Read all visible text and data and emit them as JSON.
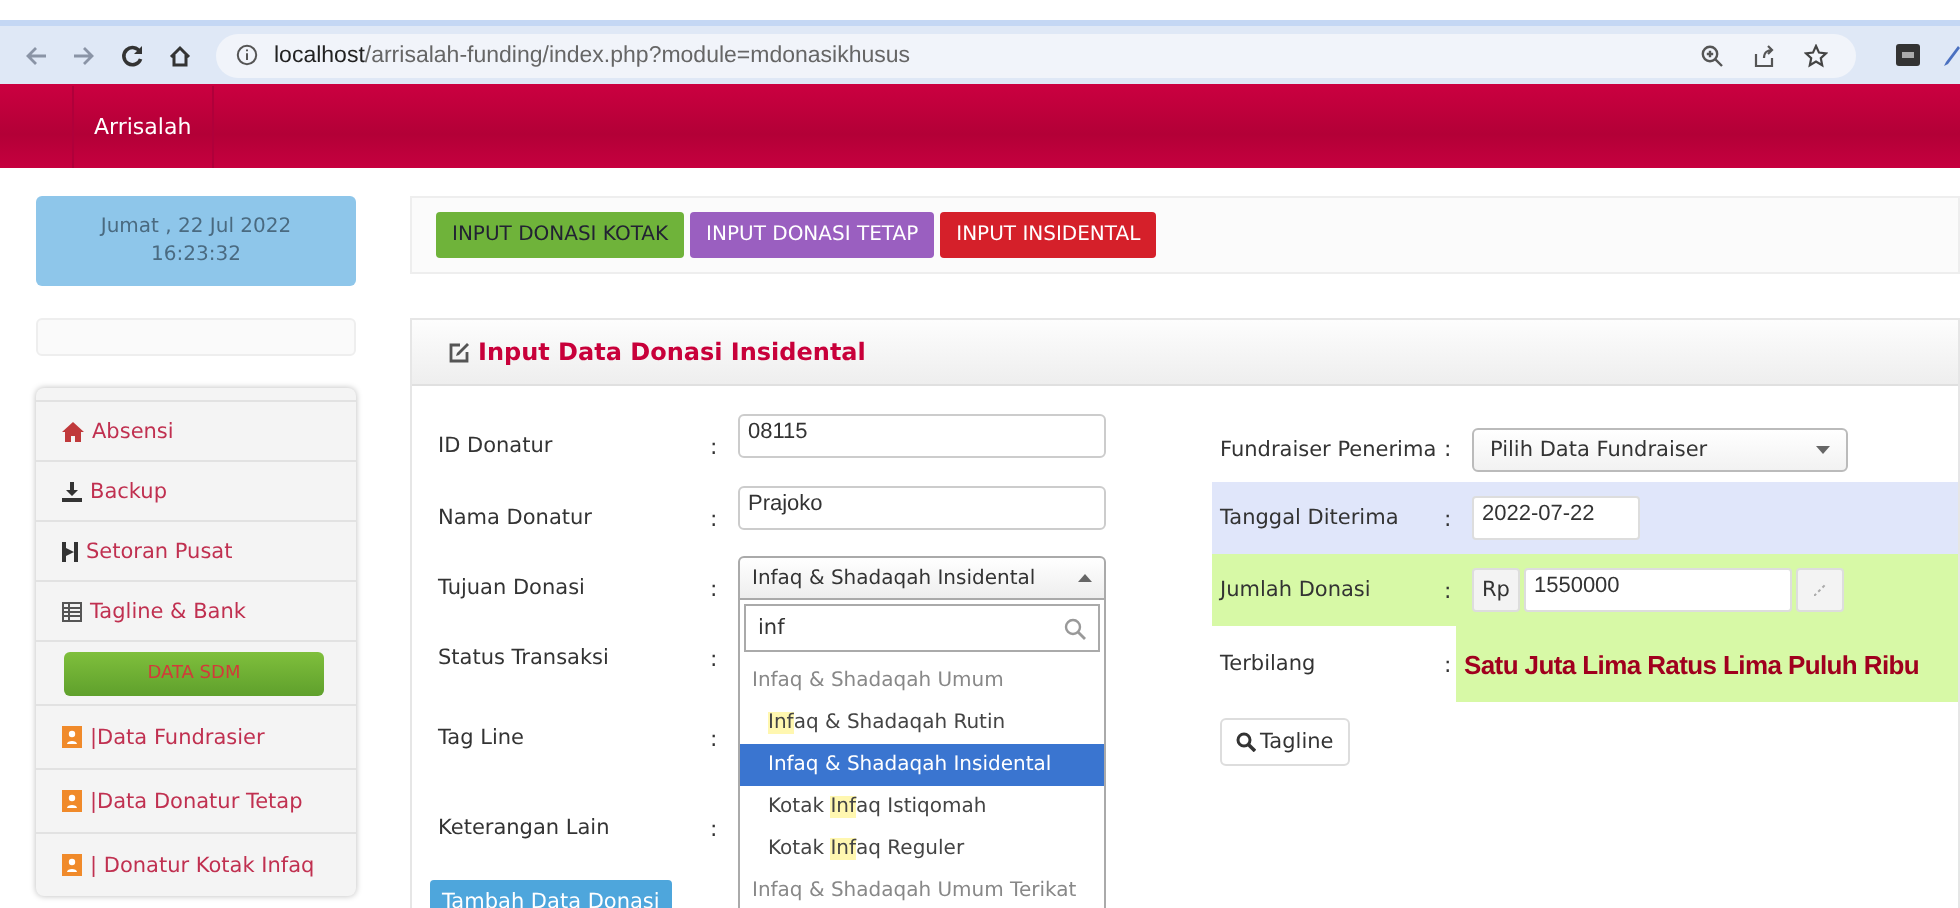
{
  "browser": {
    "url_host": "localhost",
    "url_path": "/arrisalah-funding/index.php?module=mdonasikhusus"
  },
  "navbar": {
    "brand": "Arrisalah"
  },
  "sidebar": {
    "date": "Jumat , 22 Jul 2022",
    "time": "16:23:32",
    "items": [
      {
        "kind": "home",
        "label": "Absensi"
      },
      {
        "kind": "download",
        "label": "Backup"
      },
      {
        "kind": "bar",
        "label": "Setoran Pusat"
      },
      {
        "kind": "table",
        "label": "Tagline & Bank"
      },
      {
        "kind": "button",
        "label": "DATA SDM"
      },
      {
        "kind": "user",
        "label": "|Data Fundrasier"
      },
      {
        "kind": "user",
        "label": "|Data Donatur Tetap"
      },
      {
        "kind": "user",
        "label": "| Donatur Kotak Infaq"
      }
    ]
  },
  "tabs": [
    {
      "label": "INPUT DONASI KOTAK",
      "color": "#6fb33a"
    },
    {
      "label": "INPUT DONASI TETAP",
      "color": "#9a5fc0"
    },
    {
      "label": "INPUT INSIDENTAL",
      "color": "#d5202a"
    }
  ],
  "form": {
    "title": "Input Data Donasi Insidental",
    "left_rows": [
      {
        "kind": "input",
        "label": "ID Donatur",
        "colon": ":",
        "value": "08115"
      },
      {
        "kind": "input",
        "label": "Nama Donatur",
        "colon": ":",
        "value": "Prajoko"
      },
      {
        "kind": "select-open",
        "label": "Tujuan Donasi",
        "colon": ":",
        "value": "Infaq & Shadaqah Insidental"
      },
      {
        "kind": "empty",
        "label": "Status Transaksi",
        "colon": ":"
      },
      {
        "kind": "empty",
        "label": "Tag Line",
        "colon": ":"
      },
      {
        "kind": "empty",
        "label": "Keterangan Lain",
        "colon": ":"
      }
    ],
    "dropdown": {
      "search": "inf",
      "options": [
        {
          "kind": "group",
          "post": "Infaq & Shadaqah Umum",
          "selected": false
        },
        {
          "kind": "option",
          "match": "Inf",
          "post": "aq & Shadaqah Rutin",
          "selected": false
        },
        {
          "kind": "option",
          "post": "Infaq & Shadaqah Insidental",
          "selected": true
        },
        {
          "kind": "option",
          "pre": "Kotak ",
          "match": "Inf",
          "post": "aq Istiqomah",
          "selected": false
        },
        {
          "kind": "option",
          "pre": "Kotak ",
          "match": "Inf",
          "post": "aq Reguler",
          "selected": false
        },
        {
          "kind": "group",
          "post": "Infaq & Shadaqah Umum Terikat",
          "selected": false
        }
      ]
    },
    "right_rows": [
      {
        "kind": "select",
        "label": "Fundraiser Penerima",
        "colon": ":",
        "value": "Pilih Data Fundraiser"
      },
      {
        "kind": "date",
        "label": "Tanggal Diterima",
        "colon": ":",
        "value": "2022-07-22",
        "color": "#e0e6fa"
      },
      {
        "kind": "money",
        "label": "Jumlah Donasi",
        "colon": ":",
        "prefix": "Rp",
        "value": "1550000",
        "color": "#d7f9a6"
      },
      {
        "kind": "words",
        "label": "Terbilang",
        "colon": ":",
        "value": "Satu Juta Lima Ratus Lima Puluh Ribu",
        "color": "#d7f9a6"
      }
    ],
    "tagline_button": "Tagline",
    "submit_button": "Tambah Data Donasi"
  }
}
